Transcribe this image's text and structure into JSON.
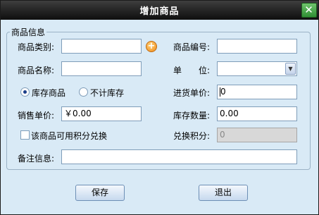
{
  "window": {
    "title": "增加商品",
    "close_glyph": "✕"
  },
  "group": {
    "legend": "商品信息"
  },
  "fields": {
    "category": {
      "label": "商品类别:",
      "value": ""
    },
    "code": {
      "label": "商品编号:",
      "value": ""
    },
    "name": {
      "label": "商品名称:",
      "value": ""
    },
    "unit": {
      "label": "单　　位:",
      "value": ""
    },
    "stock_mode": {
      "options": [
        {
          "label": "库存商品",
          "checked": true
        },
        {
          "label": "不计库存",
          "checked": false
        }
      ]
    },
    "purchase_price": {
      "label": "进货单价:",
      "value": "0"
    },
    "sale_price": {
      "label": "销售单价:",
      "value": "￥0.00"
    },
    "stock_qty": {
      "label": "库存数量:",
      "value": "0.00"
    },
    "points_redeemable": {
      "label": "该商品可用积分兑换",
      "checked": false
    },
    "redeem_points": {
      "label": "兑换积分:",
      "value": "0"
    },
    "remarks": {
      "label": "备注信息:",
      "value": ""
    }
  },
  "buttons": {
    "save": "保存",
    "exit": "退出"
  },
  "icons": {
    "add": "add-icon",
    "dropdown": "chevron-down-icon",
    "close": "close-icon"
  },
  "colors": {
    "titlebar": "#1a1a1a",
    "close_button": "#3fa33f",
    "dialog_background": "#d9eaf6",
    "add_icon": "#f08a18"
  }
}
